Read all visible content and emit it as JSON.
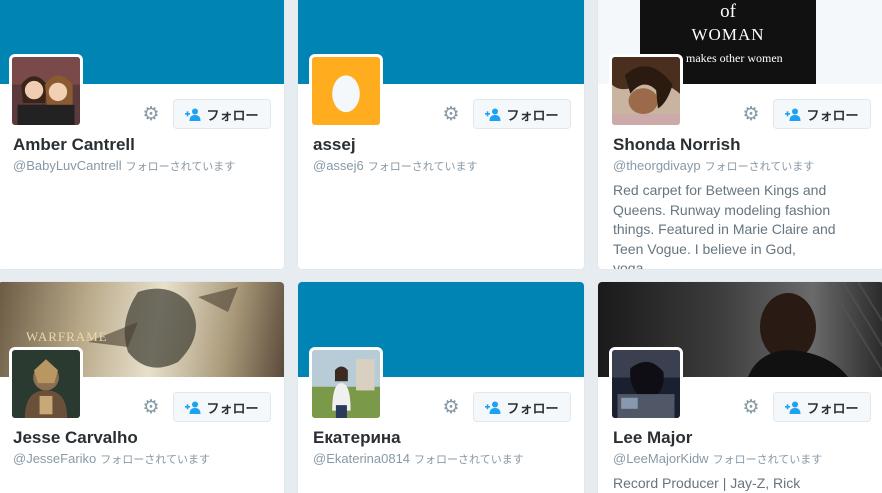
{
  "follow_label": "フォロー",
  "gear_glyph": "⚙",
  "accent_color": "#0084b4",
  "cards": [
    {
      "name": "Amber Cantrell",
      "handle": "@BabyLuvCantrell",
      "follows_you": "フォローされています",
      "bio": ""
    },
    {
      "name": "assej",
      "handle": "@assej6",
      "follows_you": "フォローされています",
      "bio": ""
    },
    {
      "name": "Shonda Norrish",
      "handle": "@theorgdivayp",
      "follows_you": "フォローされています",
      "bio": "Red carpet for Between Kings and Queens. Runway modeling fashion things. Featured in Marie Claire and Teen Vogue. I believe in God, yoga,...",
      "banner_text_1": "of",
      "banner_text_2": "WOMAN",
      "banner_text_3": "makes other women"
    },
    {
      "name": "Jesse Carvalho",
      "handle": "@JesseFariko",
      "follows_you": "フォローされています",
      "bio": "",
      "banner_text_1": "WARFRAME"
    },
    {
      "name": "Екатерина",
      "handle": "@Ekaterina0814",
      "follows_you": "フォローされています",
      "bio": ""
    },
    {
      "name": "Lee Major",
      "handle": "@LeeMajorKidw",
      "follows_you": "フォローされています",
      "bio": "Record Producer | Jay-Z, Rick"
    }
  ]
}
